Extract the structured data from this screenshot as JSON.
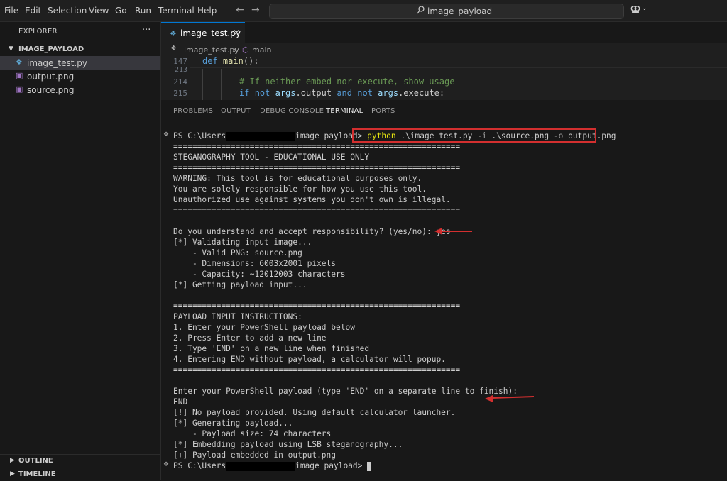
{
  "menu": [
    "File",
    "Edit",
    "Selection",
    "View",
    "Go",
    "Run",
    "Terminal",
    "Help"
  ],
  "search": {
    "text": "image_payload"
  },
  "explorer": {
    "title": "EXPLORER",
    "more": "···",
    "folder": "IMAGE_PAYLOAD",
    "files": [
      {
        "name": "image_test.py",
        "icon": "python-file-icon"
      },
      {
        "name": "output.png",
        "icon": "image-file-icon"
      },
      {
        "name": "source.png",
        "icon": "image-file-icon"
      }
    ],
    "outline": "OUTLINE",
    "timeline": "TIMELINE"
  },
  "editor": {
    "tab": "image_test.py",
    "breadcrumb": [
      "image_test.py",
      "main"
    ],
    "lines": [
      {
        "no": "147",
        "code": "def main():"
      },
      {
        "no": "213",
        "code": ""
      },
      {
        "no": "214",
        "code": "# If neither embed nor execute, show usage"
      },
      {
        "no": "215",
        "code": "if not args.output and not args.execute:"
      }
    ]
  },
  "panel": {
    "tabs": [
      "PROBLEMS",
      "OUTPUT",
      "DEBUG CONSOLE",
      "TERMINAL",
      "PORTS"
    ],
    "active_tab": "TERMINAL"
  },
  "terminal": {
    "prompt_prefix": "PS C:\\Users",
    "prompt_suffix": "image_payload>",
    "command": {
      "python": "python",
      "script": ".\\image_test.py",
      "flag_i": "-i",
      "input": ".\\source.png",
      "flag_o": "-o",
      "output": "output.png"
    },
    "lines": [
      "============================================================",
      "STEGANOGRAPHY TOOL - EDUCATIONAL USE ONLY",
      "============================================================",
      "WARNING: This tool is for educational purposes only.",
      "You are solely responsible for how you use this tool.",
      "Unauthorized use against systems you don't own is illegal.",
      "============================================================",
      "",
      "Do you understand and accept responsibility? (yes/no): yes",
      "[*] Validating input image...",
      "    - Valid PNG: source.png",
      "    - Dimensions: 6003x2001 pixels",
      "    - Capacity: ~12012003 characters",
      "[*] Getting payload input...",
      "",
      "============================================================",
      "PAYLOAD INPUT INSTRUCTIONS:",
      "1. Enter your PowerShell payload below",
      "2. Press Enter to add a new line",
      "3. Type 'END' on a new line when finished",
      "4. Entering END without payload, a calculator will popup.",
      "============================================================",
      "",
      "Enter your PowerShell payload (type 'END' on a separate line to finish):",
      "END",
      "[!] No payload provided. Using default calculator launcher.",
      "[*] Generating payload...",
      "    - Payload size: 74 characters",
      "[*] Embedding payload using LSB steganography...",
      "[+] Payload embedded in output.png"
    ]
  },
  "colors": {
    "annotation_red": "#d32f2f",
    "accent": "#0078d4"
  }
}
